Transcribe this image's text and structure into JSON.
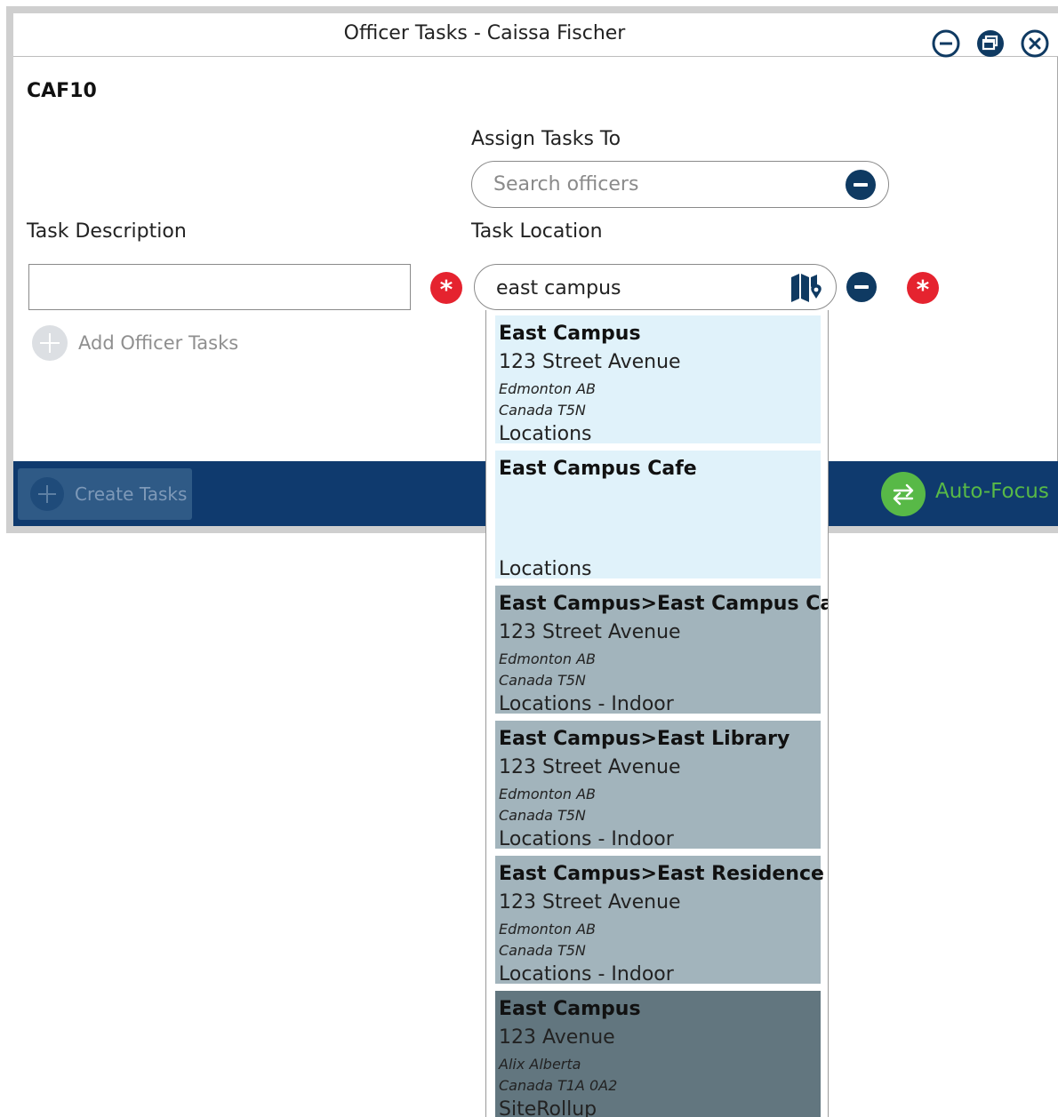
{
  "window": {
    "title": "Officer Tasks - Caissa Fischer",
    "record_id": "CAF10"
  },
  "assign": {
    "label": "Assign Tasks To",
    "placeholder": "Search officers"
  },
  "task_description": {
    "label": "Task Description",
    "value": ""
  },
  "task_location": {
    "label": "Task Location",
    "value": "east campus"
  },
  "add_officer_tasks_label": "Add Officer Tasks",
  "footer": {
    "create_label": "Create Tasks",
    "autofocus_label": "Auto-Focus"
  },
  "colors": {
    "accent_navy": "#0f3a6e",
    "required_red": "#e5232f",
    "autofocus_green": "#58b947",
    "item_location_bg": "#e0f2fa",
    "item_indoor_bg": "#a2b4bc",
    "item_site_bg": "#62767f"
  },
  "results": [
    {
      "name": "East Campus",
      "street": "123 Street Avenue",
      "city": "Edmonton AB",
      "country": "Canada T5N",
      "type": "Locations",
      "kind": "location"
    },
    {
      "name": "East Campus Cafe",
      "street": "",
      "city": "",
      "country": "",
      "type": "Locations",
      "kind": "location"
    },
    {
      "name": "East Campus>East Campus Cafe",
      "street": "123 Street Avenue",
      "city": "Edmonton AB",
      "country": "Canada T5N",
      "type": "Locations - Indoor",
      "kind": "indoor"
    },
    {
      "name": "East Campus>East Library",
      "street": "123 Street Avenue",
      "city": "Edmonton AB",
      "country": "Canada T5N",
      "type": "Locations - Indoor",
      "kind": "indoor"
    },
    {
      "name": "East Campus>East Residence",
      "street": "123 Street Avenue",
      "city": "Edmonton AB",
      "country": "Canada T5N",
      "type": "Locations - Indoor",
      "kind": "indoor"
    },
    {
      "name": "East Campus",
      "street": "123 Avenue",
      "city": "Alix Alberta",
      "country": "Canada T1A 0A2",
      "type": "SiteRollup",
      "kind": "site"
    }
  ]
}
